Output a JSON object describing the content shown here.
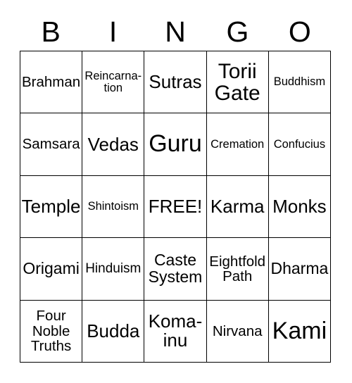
{
  "card": {
    "title": "BINGO",
    "header_letters": [
      "B",
      "I",
      "N",
      "G",
      "O"
    ],
    "colors": {
      "background": "#ffffff",
      "text": "#000000",
      "border": "#000000"
    },
    "free_space_label": "FREE!",
    "grid": {
      "columns": 5,
      "rows": 5,
      "cells": [
        {
          "label": "Brahman",
          "size": "fs-ml"
        },
        {
          "label": "Reincarna-\ntion",
          "size": "fs-s"
        },
        {
          "label": "Sutras",
          "size": "fs-xl"
        },
        {
          "label": "Torii\nGate",
          "size": "fs-xxl"
        },
        {
          "label": "Buddhism",
          "size": "fs-s"
        },
        {
          "label": "Samsara",
          "size": "fs-ml"
        },
        {
          "label": "Vedas",
          "size": "fs-xl"
        },
        {
          "label": "Guru",
          "size": "fs-max"
        },
        {
          "label": "Cremation",
          "size": "fs-s"
        },
        {
          "label": "Confucius",
          "size": "fs-s"
        },
        {
          "label": "Temple",
          "size": "fs-xl"
        },
        {
          "label": "Shintoism",
          "size": "fs-s"
        },
        {
          "label": "FREE!",
          "size": "fs-xl"
        },
        {
          "label": "Karma",
          "size": "fs-xl"
        },
        {
          "label": "Monks",
          "size": "fs-xl"
        },
        {
          "label": "Origami",
          "size": "fs-l"
        },
        {
          "label": "Hinduism",
          "size": "fs-m"
        },
        {
          "label": "Caste\nSystem",
          "size": "fs-l"
        },
        {
          "label": "Eightfold\nPath",
          "size": "fs-ml"
        },
        {
          "label": "Dharma",
          "size": "fs-l"
        },
        {
          "label": "Four\nNoble\nTruths",
          "size": "fs-ml"
        },
        {
          "label": "Budda",
          "size": "fs-xl"
        },
        {
          "label": "Koma-\ninu",
          "size": "fs-xl"
        },
        {
          "label": "Nirvana",
          "size": "fs-ml"
        },
        {
          "label": "Kami",
          "size": "fs-max"
        }
      ]
    }
  }
}
